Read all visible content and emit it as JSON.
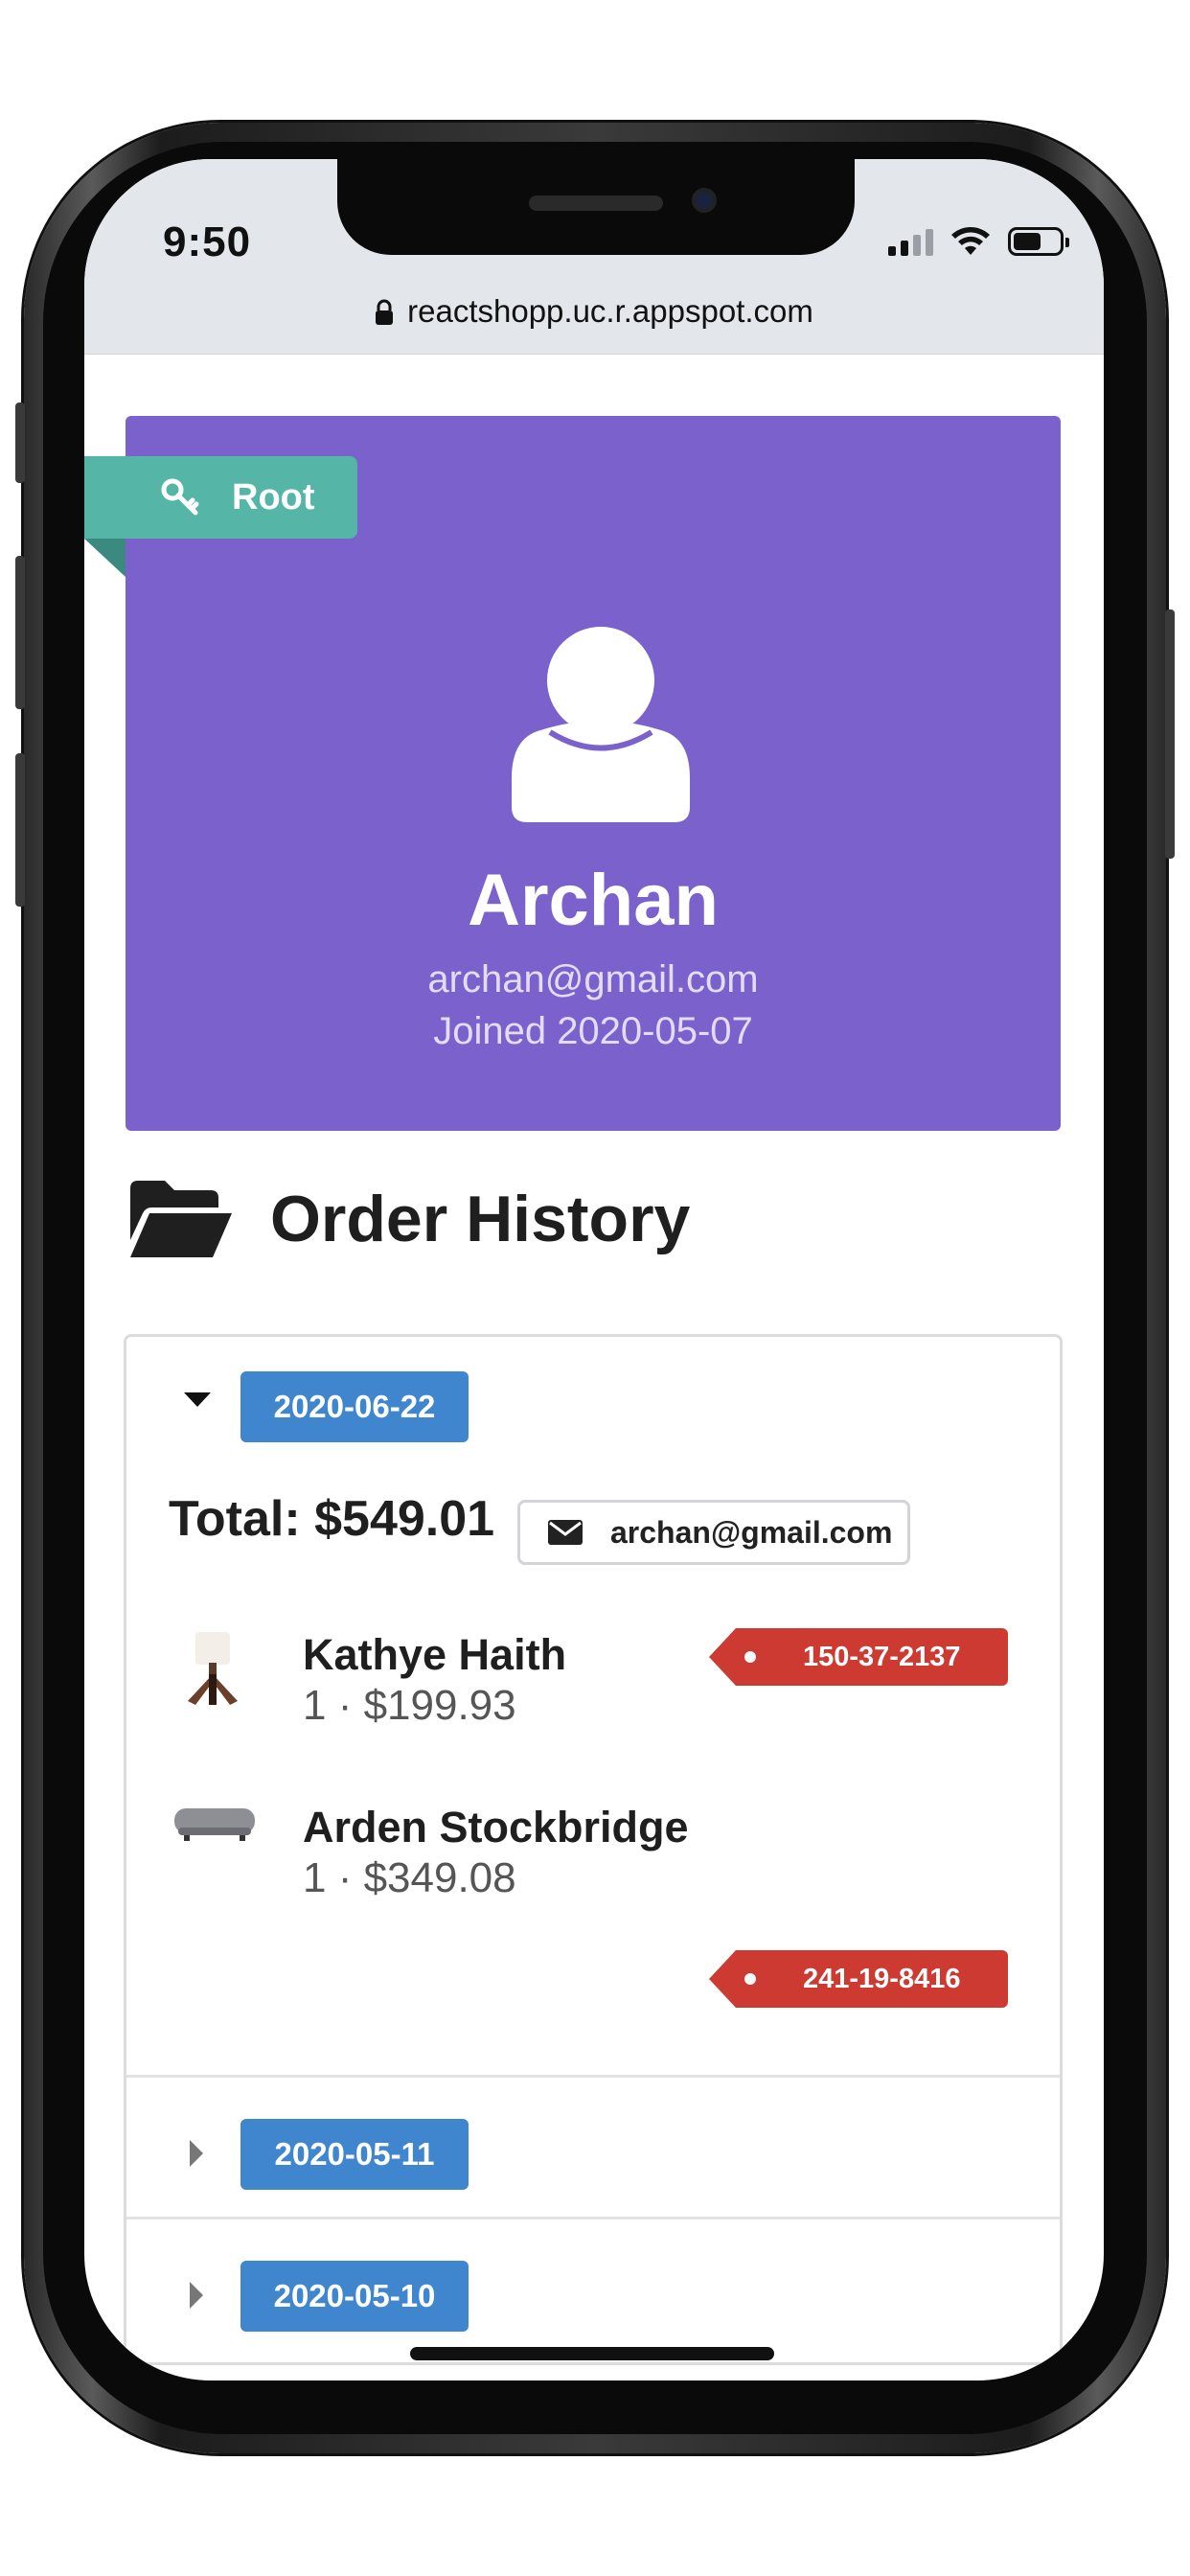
{
  "status_bar": {
    "time": "9:50",
    "url": "reactshopp.uc.r.appspot.com"
  },
  "profile": {
    "role_badge": "Root",
    "name": "Archan",
    "email": "archan@gmail.com",
    "joined": "Joined 2020-05-07",
    "card_color": "#7b61cc",
    "badge_color": "#55b5a7"
  },
  "order_history": {
    "title": "Order History",
    "orders": [
      {
        "date": "2020-06-22",
        "expanded": true,
        "total": "Total: $549.01",
        "email": "archan@gmail.com",
        "items": [
          {
            "name": "Kathye Haith",
            "meta": "1 · $199.93",
            "tag": "150-37-2137"
          },
          {
            "name": "Arden Stockbridge",
            "meta": "1 · $349.08",
            "tag": "241-19-8416"
          }
        ]
      },
      {
        "date": "2020-05-11",
        "expanded": false
      },
      {
        "date": "2020-05-10",
        "expanded": false
      }
    ]
  },
  "colors": {
    "date_label": "#3f86cf",
    "tag_red": "#cc3a32"
  }
}
